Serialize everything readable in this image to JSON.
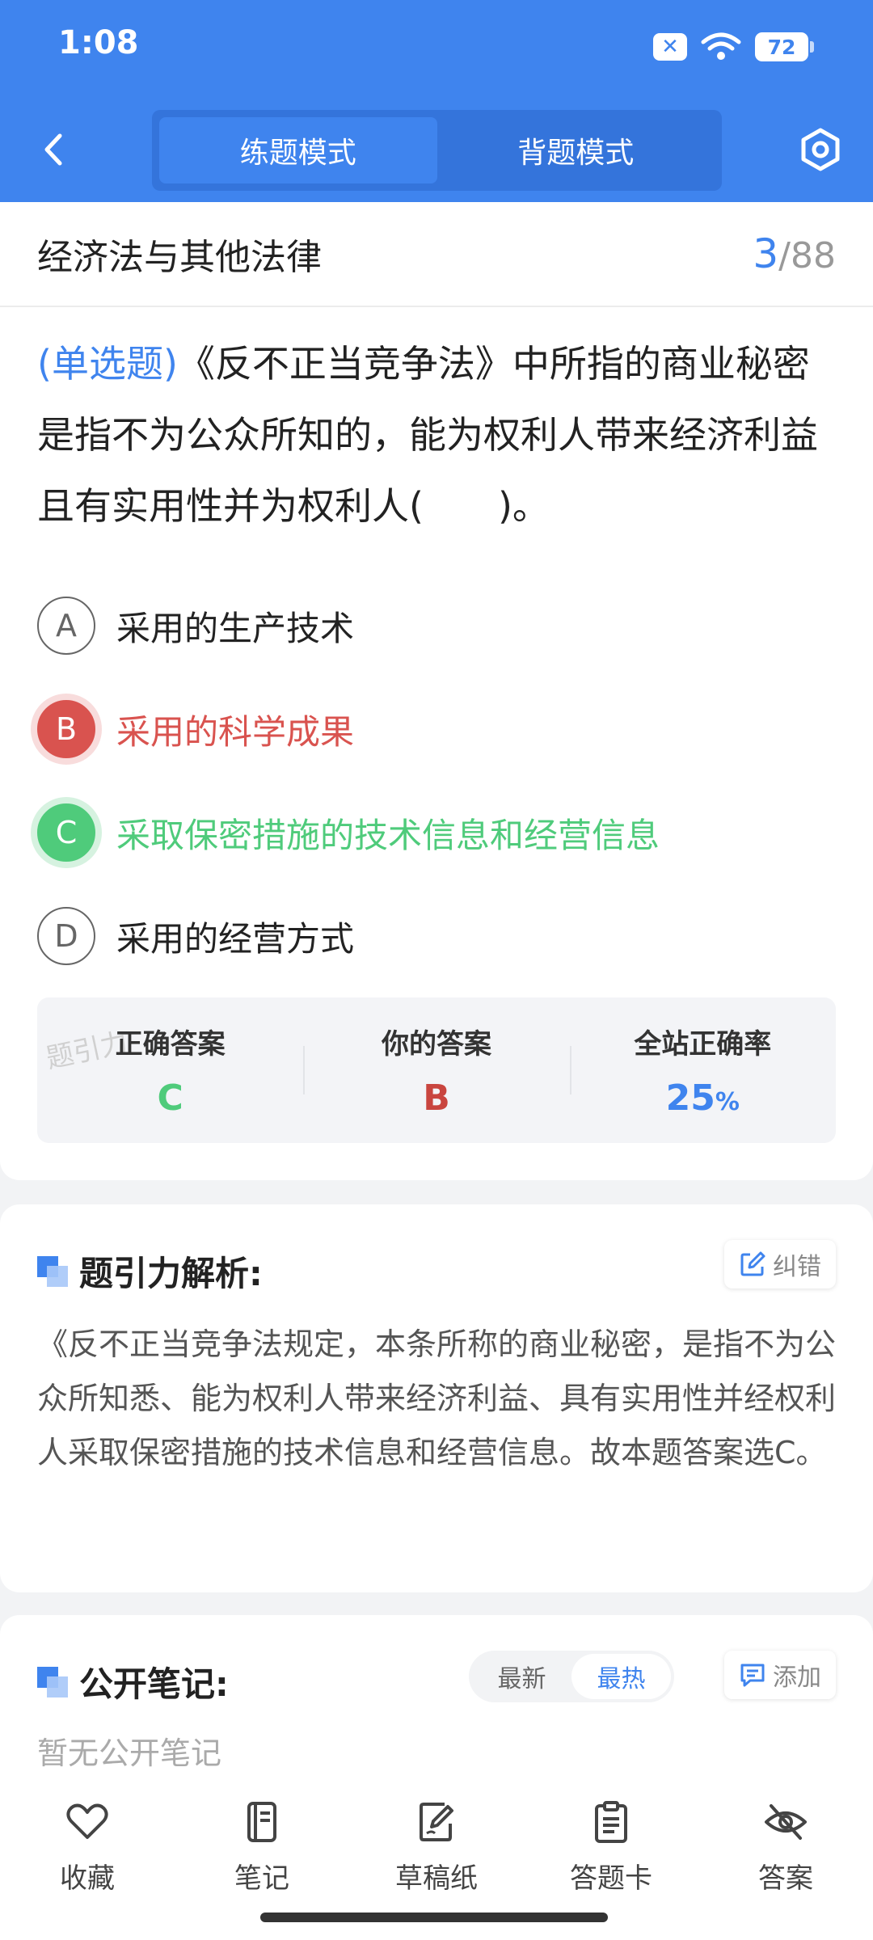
{
  "status_bar": {
    "time": "1:08",
    "battery": "72",
    "sim_icon": "sim-off-icon",
    "wifi_icon": "wifi-icon"
  },
  "header": {
    "tabs": [
      {
        "label": "练题模式",
        "active": true
      },
      {
        "label": "背题模式",
        "active": false
      }
    ],
    "back_icon": "chevron-left-icon",
    "settings_icon": "hexagon-settings-icon"
  },
  "chapter": {
    "title": "经济法与其他法律",
    "current": "3",
    "separator": "/",
    "total": "88"
  },
  "question": {
    "type": "(单选题)",
    "text": "《反不正当竞争法》中所指的商业秘密是指不为公众所知的，能为权利人带来经济利益且有实用性并为权利人(　　)。"
  },
  "options": [
    {
      "letter": "A",
      "text": "采用的生产技术",
      "state": "normal"
    },
    {
      "letter": "B",
      "text": "采用的科学成果",
      "state": "wrong"
    },
    {
      "letter": "C",
      "text": "采取保密措施的技术信息和经营信息",
      "state": "right"
    },
    {
      "letter": "D",
      "text": "采用的经营方式",
      "state": "normal"
    }
  ],
  "answer_summary": {
    "correct_label": "正确答案",
    "correct_value": "C",
    "yours_label": "你的答案",
    "yours_value": "B",
    "rate_label": "全站正确率",
    "rate_value": "25",
    "rate_unit": "%",
    "watermark": "题引力"
  },
  "analysis": {
    "title": "题引力解析:",
    "report_label": "纠错",
    "text": "《反不正当竞争法规定，本条所称的商业秘密，是指不为公众所知悉、能为权利人带来经济利益、具有实用性并经权利人采取保密措施的技术信息和经营信息。故本题答案选C。"
  },
  "notes": {
    "title": "公开笔记:",
    "sort_options": [
      {
        "label": "最新",
        "active": false
      },
      {
        "label": "最热",
        "active": true
      }
    ],
    "add_label": "添加",
    "empty_text": "暂无公开笔记"
  },
  "bottom_bar": [
    {
      "label": "收藏",
      "icon": "heart-icon"
    },
    {
      "label": "笔记",
      "icon": "notebook-icon"
    },
    {
      "label": "草稿纸",
      "icon": "draft-pen-icon"
    },
    {
      "label": "答题卡",
      "icon": "clipboard-icon"
    },
    {
      "label": "答案",
      "icon": "eye-off-icon"
    }
  ],
  "colors": {
    "primary": "#3f84ee",
    "correct": "#4fcb7b",
    "wrong": "#d9534f"
  }
}
